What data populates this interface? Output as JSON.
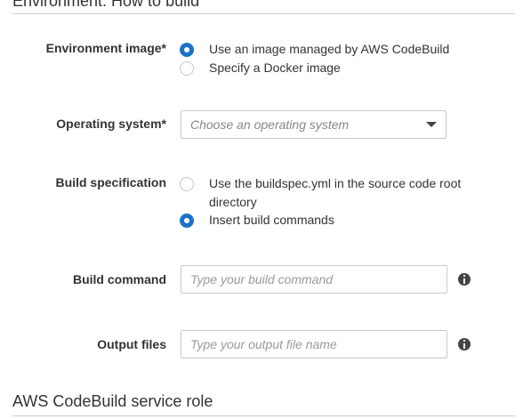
{
  "sections": {
    "environment_title": "Environment: How to build",
    "service_role_title": "AWS CodeBuild service role"
  },
  "environment_image": {
    "label": "Environment image*",
    "options": [
      {
        "label": "Use an image managed by AWS CodeBuild",
        "selected": true
      },
      {
        "label": "Specify a Docker image",
        "selected": false
      }
    ]
  },
  "operating_system": {
    "label": "Operating system*",
    "placeholder": "Choose an operating system"
  },
  "build_specification": {
    "label": "Build specification",
    "options": [
      {
        "label_line1": "Use the buildspec.yml in the source code root",
        "label_line2": "directory",
        "selected": false
      },
      {
        "label": "Insert build commands",
        "selected": true
      }
    ]
  },
  "build_command": {
    "label": "Build command",
    "placeholder": "Type your build command",
    "info_icon": "info-icon"
  },
  "output_files": {
    "label": "Output files",
    "placeholder": "Type your output file name",
    "info_icon": "info-icon"
  },
  "colors": {
    "radio_selected": "#1a73c8",
    "label_text": "#333333",
    "placeholder_text": "#9a9a9a"
  }
}
